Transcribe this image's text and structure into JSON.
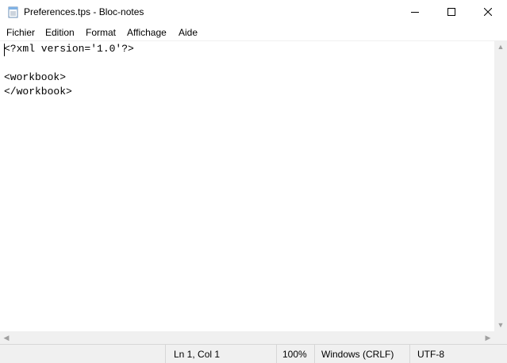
{
  "window": {
    "title": "Preferences.tps - Bloc-notes",
    "icon": "notepad-icon",
    "controls": [
      "minimize-icon",
      "maximize-icon",
      "close-icon"
    ]
  },
  "menu": {
    "items": [
      "Fichier",
      "Edition",
      "Format",
      "Affichage",
      "Aide"
    ]
  },
  "editor": {
    "lines": [
      "<?xml version='1.0'?>",
      "",
      "<workbook>",
      "</workbook>"
    ]
  },
  "status": {
    "position": "Ln 1, Col 1",
    "zoom": "100%",
    "line_ending": "Windows (CRLF)",
    "encoding": "UTF-8"
  }
}
